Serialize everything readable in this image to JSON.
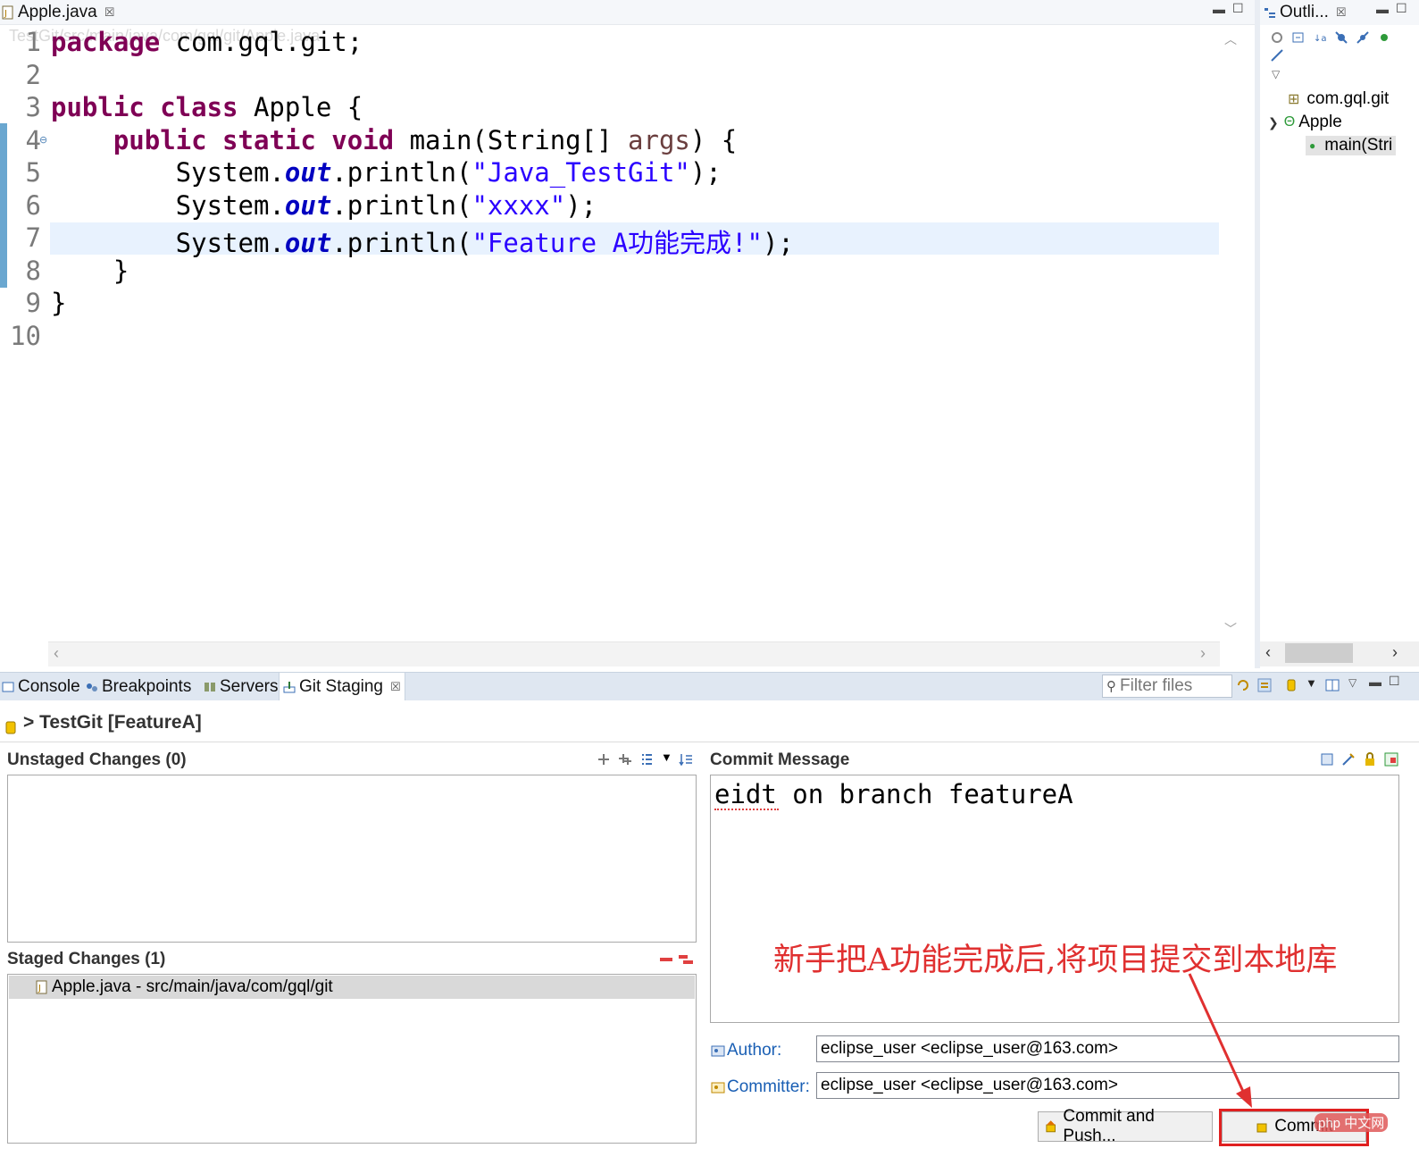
{
  "editor": {
    "tab_label": "Apple.java",
    "tab_close": "☒",
    "breadcrumb": "TestGit/src/main/java/com/gql/git/Apple.java",
    "line_numbers": [
      "1",
      "2",
      "3",
      "4",
      "5",
      "6",
      "7",
      "8",
      "9",
      "10"
    ],
    "code": {
      "l1_kw": "package",
      "l1_rest": " com.gql.git;",
      "l3_kw": "public class",
      "l3_rest": " Apple {",
      "l4_indent": "    ",
      "l4_kw": "public static void",
      "l4_a": " main(String[] ",
      "l4_arg": "args",
      "l4_b": ") {",
      "l5_a": "        System.",
      "l5_fld": "out",
      "l5_b": ".println(",
      "l5_str": "\"Java_TestGit\"",
      "l5_c": ");",
      "l6_a": "        System.",
      "l6_fld": "out",
      "l6_b": ".println(",
      "l6_str": "\"xxxx\"",
      "l6_c": ");",
      "l7_a": "        System.",
      "l7_fld": "out",
      "l7_b": ".println(",
      "l7_str": "\"Feature A功能完成!\"",
      "l7_c": ");",
      "l8": "    }",
      "l9": "}"
    }
  },
  "outline": {
    "tab_label": "Outli...",
    "tab_close": "☒",
    "items": [
      "com.gql.git",
      "Apple",
      "main(Stri"
    ]
  },
  "bottom_tabs": [
    {
      "label": "Console"
    },
    {
      "label": "Breakpoints"
    },
    {
      "label": "Servers"
    },
    {
      "label": "Git Staging",
      "close": "☒"
    }
  ],
  "filter": {
    "placeholder": "Filter files"
  },
  "repo": {
    "title": "> TestGit [FeatureA]"
  },
  "unstaged": {
    "title": "Unstaged Changes (0)"
  },
  "staged": {
    "title": "Staged Changes (1)",
    "items": [
      "Apple.java - src/main/java/com/gql/git"
    ]
  },
  "commit": {
    "title": "Commit Message",
    "message": "eidt on branch featureA",
    "author_label": "Author:",
    "author_value": "eclipse_user <eclipse_user@163.com>",
    "committer_label": "Committer:",
    "committer_value": "eclipse_user <eclipse_user@163.com>",
    "commit_push_label": "Commit and Push...",
    "commit_label": "Commit"
  },
  "annotation": {
    "text": "新手把A功能完成后,将项目提交到本地库",
    "color": "#e03030"
  },
  "watermark": {
    "text": "php 中文网"
  }
}
